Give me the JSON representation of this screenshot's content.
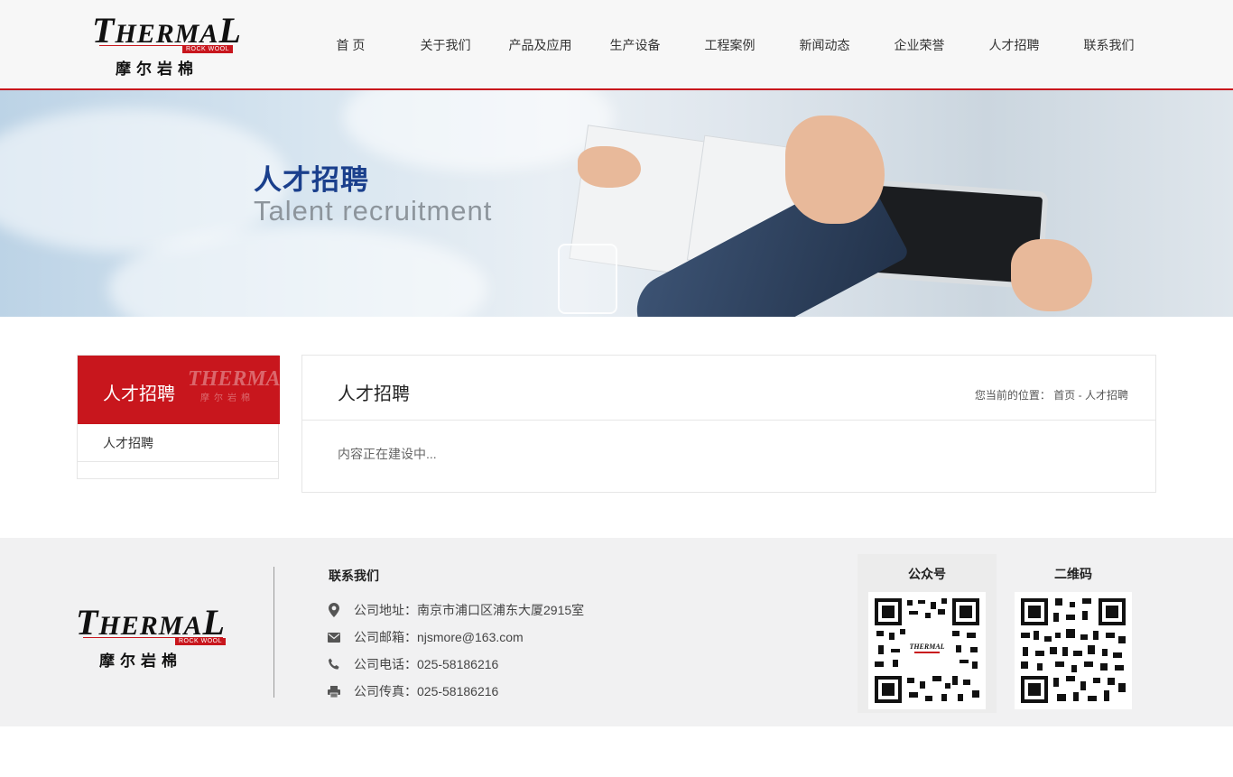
{
  "header": {
    "logo_word": "THERMAL",
    "logo_sub": "ROCK WOOL",
    "logo_cn": "摩尔岩棉",
    "nav": [
      "首  页",
      "关于我们",
      "产品及应用",
      "生产设备",
      "工程案例",
      "新闻动态",
      "企业荣誉",
      "人才招聘",
      "联系我们"
    ]
  },
  "banner": {
    "title": "人才招聘",
    "subtitle": "Talent recruitment"
  },
  "sidebar": {
    "title": "人才招聘",
    "watermark_word": "THERMAL",
    "watermark_cn": "摩尔岩棉",
    "items": [
      {
        "label": "人才招聘"
      }
    ]
  },
  "content": {
    "title": "人才招聘",
    "breadcrumb_prefix": "您当前的位置：",
    "breadcrumb_home": "首页",
    "breadcrumb_sep": "-",
    "breadcrumb_current": "人才招聘",
    "body": "内容正在建设中..."
  },
  "footer": {
    "logo_word": "THERMAL",
    "logo_sub": "ROCK WOOL",
    "logo_cn": "摩尔岩棉",
    "contact_title": "联系我们",
    "address": "公司地址：南京市浦口区浦东大厦2915室",
    "email": "公司邮箱：njsmore@163.com",
    "phone": "公司电话：025-58186216",
    "fax": "公司传真：025-58186216",
    "qr_wechat_label": "公众号",
    "qr_code_label": "二维码"
  },
  "colors": {
    "brand_red": "#c8161d",
    "banner_title_blue": "#1a3f8c",
    "footer_bg": "#f1f1f2"
  }
}
